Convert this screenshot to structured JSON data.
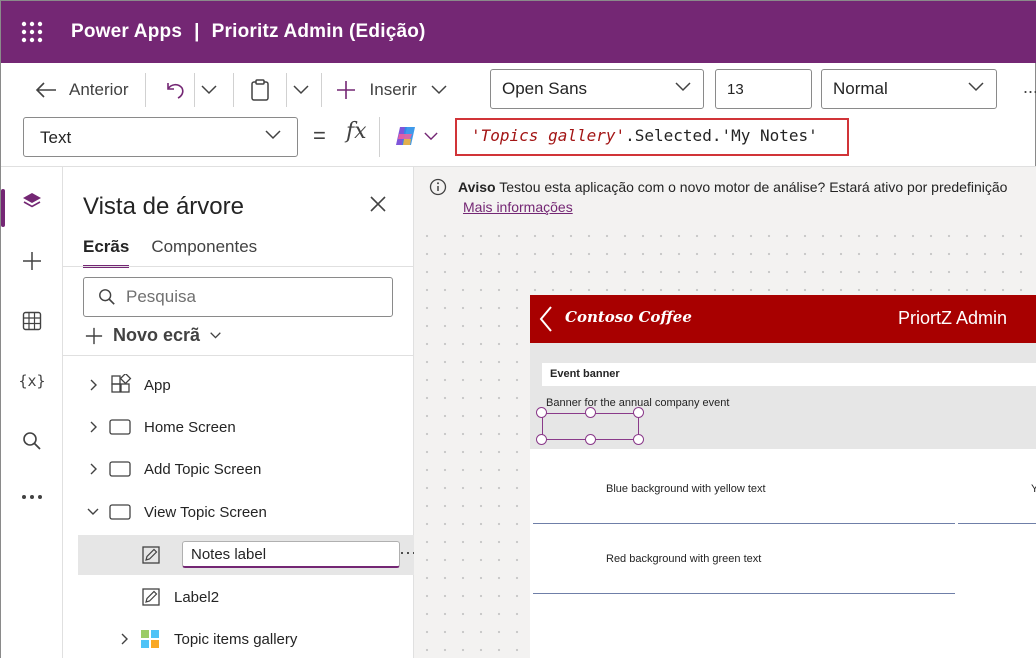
{
  "topbar": {
    "product": "Power Apps",
    "separator": "|",
    "app_title": "Prioritz Admin (Edição)"
  },
  "toolbar": {
    "back_label": "Anterior",
    "insert_label": "Inserir",
    "font_family": "Open Sans",
    "font_size": "13",
    "font_weight": "Normal",
    "more": "..."
  },
  "formula_bar": {
    "property": "Text",
    "equals": "=",
    "fx": "fx",
    "formula_part1": "'Topics gallery'",
    "formula_part2": ".Selected.",
    "formula_part3": "'My Notes'"
  },
  "tree_view": {
    "title": "Vista de árvore",
    "tabs": [
      "Ecrãs",
      "Componentes"
    ],
    "search_placeholder": "Pesquisa",
    "new_screen": "Novo ecrã",
    "nodes": [
      {
        "label": "App"
      },
      {
        "label": "Home Screen"
      },
      {
        "label": "Add Topic Screen"
      },
      {
        "label": "View Topic Screen"
      },
      {
        "label": "Notes label"
      },
      {
        "label": "Label2"
      },
      {
        "label": "Topic items gallery"
      }
    ],
    "more": "⋯"
  },
  "notice": {
    "title": "Aviso",
    "message": "Testou esta aplicação com o novo motor de análise? Estará ativo por predefinição",
    "link": "Mais informações"
  },
  "app_preview": {
    "logo": "Contoso Coffee",
    "name": "PriortZ Admin",
    "banner_label": "Event banner",
    "banner_description": "Banner for the annual company event",
    "rows": [
      "Blue background with yellow text",
      "Red background with green text"
    ],
    "cut_text": "Y"
  },
  "colors": {
    "brand": "#742774",
    "app_header": "#a80000",
    "formula_highlight": "#d13438"
  }
}
